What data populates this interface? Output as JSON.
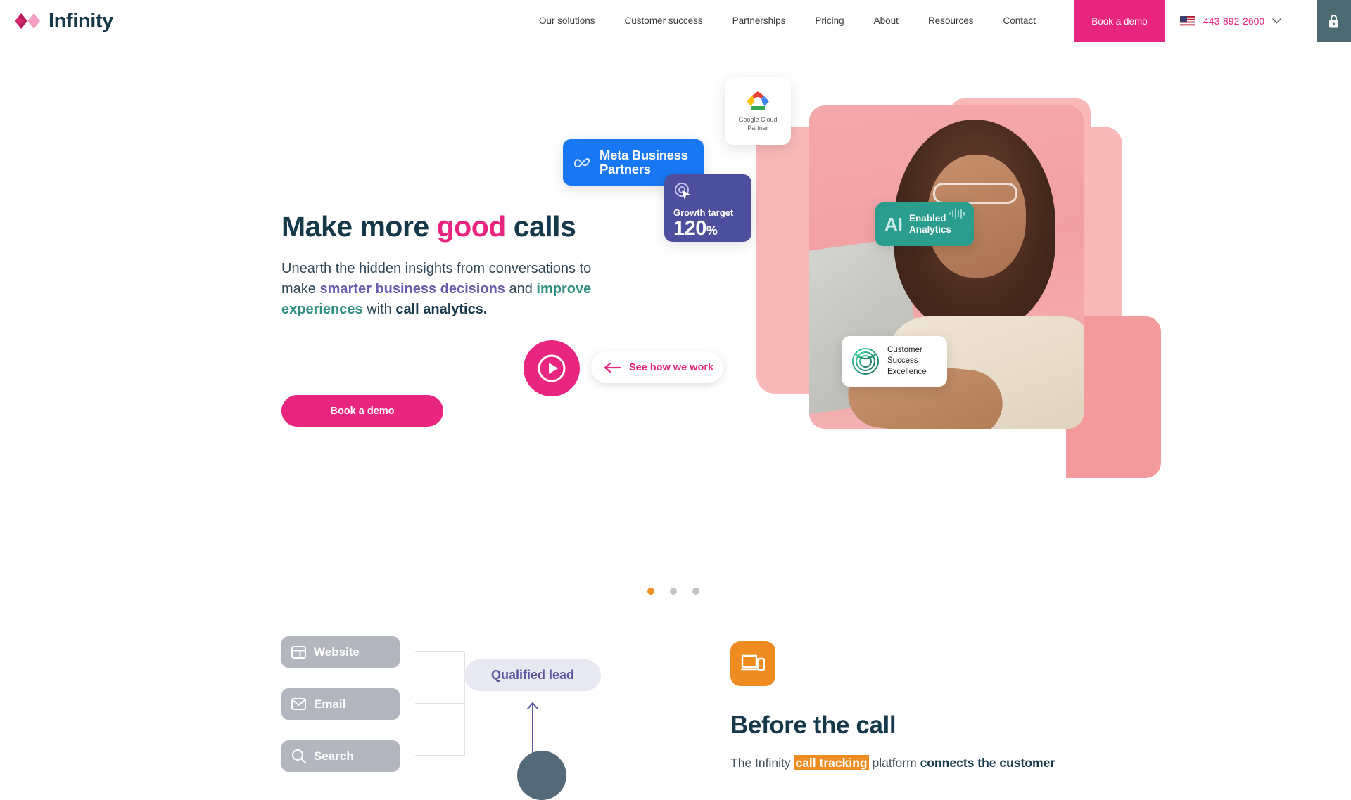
{
  "brand": {
    "name": "Infinity",
    "logo_icon": "infinity-mark-icon",
    "pink": "#e8257f",
    "navy": "#15394b",
    "purple": "#6b5aad",
    "teal": "#2e8f82",
    "orange": "#ee8c22"
  },
  "header": {
    "nav": [
      {
        "label": "Our solutions"
      },
      {
        "label": "Customer success"
      },
      {
        "label": "Partnerships"
      },
      {
        "label": "Pricing"
      },
      {
        "label": "About"
      },
      {
        "label": "Resources"
      },
      {
        "label": "Contact"
      }
    ],
    "demo_button": "Book a demo",
    "phone": "443-892-2600",
    "flag_icon": "us-flag-icon",
    "chevron_icon": "chevron-down-icon",
    "lock_icon": "lock-icon"
  },
  "hero": {
    "title_part1": "Make more ",
    "title_highlight": "good",
    "title_part2": " calls",
    "sub_1": "Unearth the hidden insights from conversations to make ",
    "sub_purple": "smarter business decisions",
    "sub_2": " and ",
    "sub_teal": "improve experiences",
    "sub_3": " with ",
    "sub_navy": "call analytics.",
    "cta": "Book a demo",
    "play_icon": "play-icon",
    "see_pill": {
      "label": "See how we work",
      "arrow_icon": "arrow-left-icon"
    },
    "badges": {
      "google_cloud": {
        "line1": "Google Cloud",
        "line2": "Partner",
        "icon": "google-cloud-icon"
      },
      "meta": {
        "line1": "Meta Business",
        "line2": "Partners",
        "icon": "meta-infinity-icon"
      },
      "growth": {
        "title": "Growth target",
        "value": "120",
        "unit": "%",
        "icon": "click-target-icon"
      },
      "ai": {
        "ai": "AI",
        "line1": "Enabled",
        "line2": "Analytics",
        "icon": "audio-waveform-icon"
      },
      "cse": {
        "line1": "Customer",
        "line2": "Success",
        "line3": "Excellence",
        "icon": "cse-emblem-icon"
      }
    },
    "carousel": {
      "slides": 3,
      "active": 1
    }
  },
  "diagram": {
    "sources": [
      {
        "label": "Website",
        "icon": "browser-window-icon"
      },
      {
        "label": "Email",
        "icon": "envelope-icon"
      },
      {
        "label": "Search",
        "icon": "search-icon"
      }
    ],
    "qualified_lead": "Qualified lead"
  },
  "section": {
    "icon": "devices-icon",
    "title": "Before the call",
    "body_1": "The Infinity ",
    "body_mark": "call tracking",
    "body_2": " platform ",
    "body_bold": "connects the customer"
  }
}
